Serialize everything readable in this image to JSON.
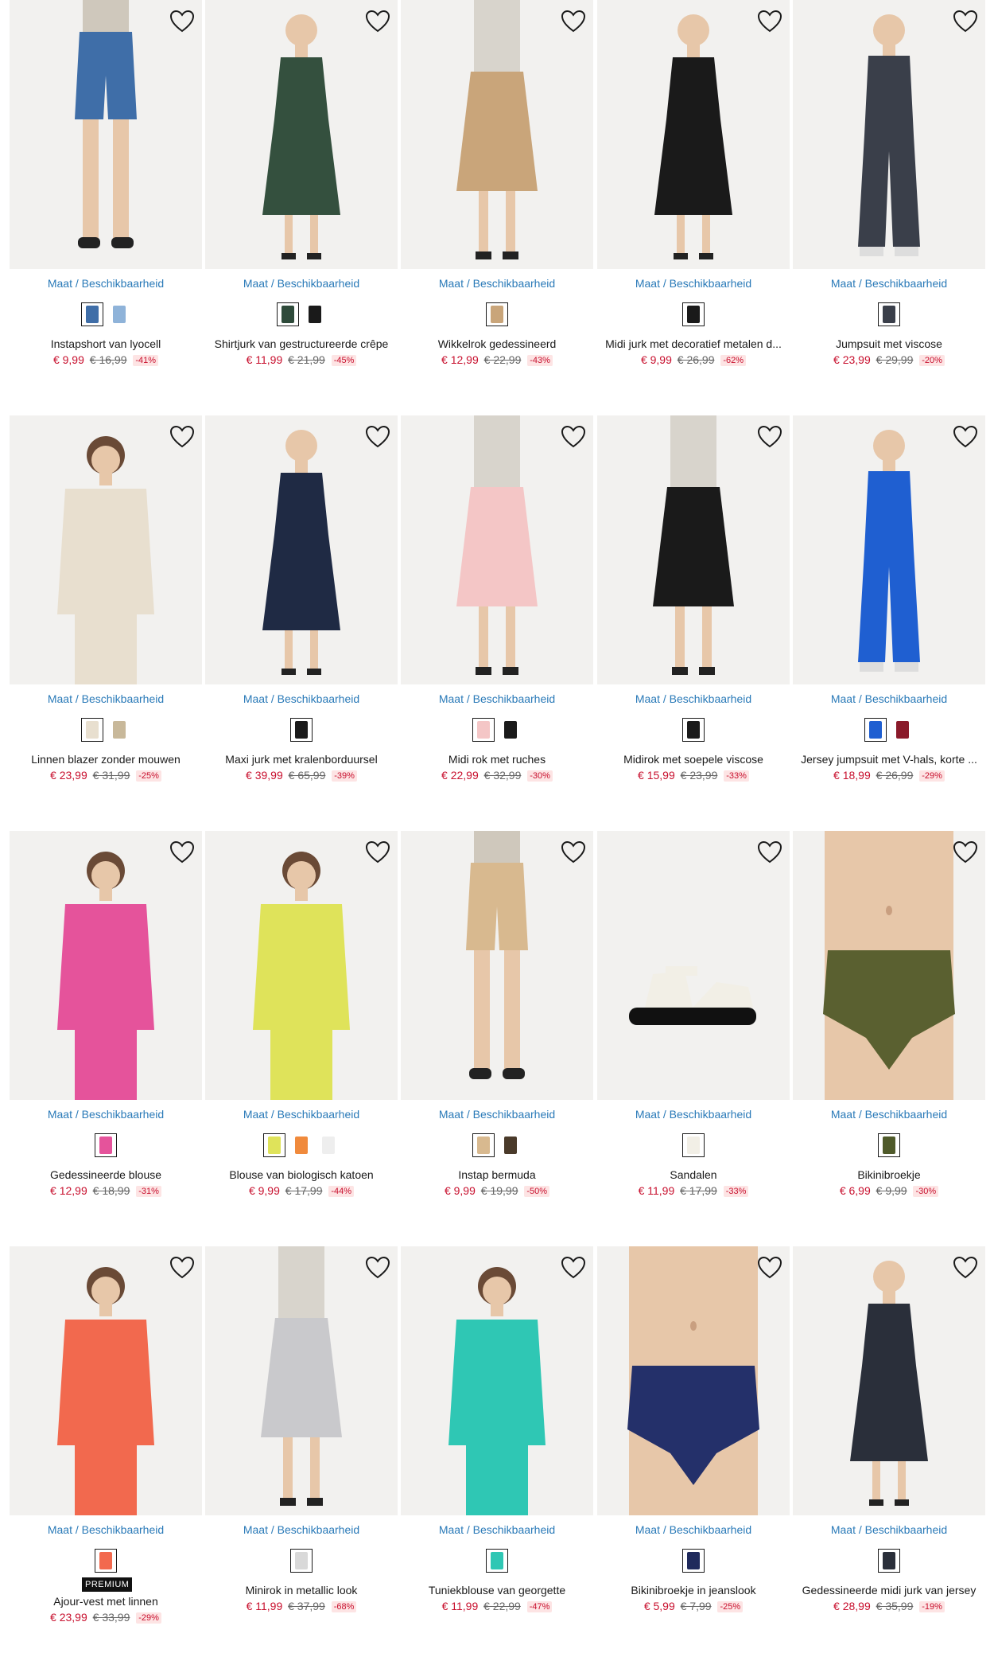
{
  "size_link_label": "Maat / Beschikbaarheid",
  "icons": {
    "wishlist": "heart-outline-icon"
  },
  "colors": {
    "price": "#c8102e",
    "link": "#2a7ab8",
    "discount_bg": "#fde4e4"
  },
  "rows": [
    {
      "products": [
        {
          "name": "Instapshort van lyocell",
          "price": "€ 9,99",
          "old_price": "€ 16,99",
          "discount": "-41%",
          "swatches": [
            "#3f6ea8",
            "#8fb3d9"
          ],
          "garment": "#3f6ea8",
          "type": "shorts"
        },
        {
          "name": "Shirtjurk van gestructureerde crêpe",
          "price": "€ 11,99",
          "old_price": "€ 21,99",
          "discount": "-45%",
          "swatches": [
            "#2e4a3a",
            "#1a1a1a"
          ],
          "garment": "#34503e",
          "type": "dress"
        },
        {
          "name": "Wikkelrok gedessineerd",
          "price": "€ 12,99",
          "old_price": "€ 22,99",
          "discount": "-43%",
          "swatches": [
            "#c9a57a"
          ],
          "garment": "#c9a57a",
          "type": "skirt"
        },
        {
          "name": "Midi jurk met decoratief metalen d...",
          "price": "€ 9,99",
          "old_price": "€ 26,99",
          "discount": "-62%",
          "swatches": [
            "#1a1a1a"
          ],
          "garment": "#1a1a1a",
          "type": "dress"
        },
        {
          "name": "Jumpsuit met viscose",
          "price": "€ 23,99",
          "old_price": "€ 29,99",
          "discount": "-20%",
          "swatches": [
            "#3a3f4a"
          ],
          "garment": "#3a3f4a",
          "type": "jumpsuit"
        }
      ]
    },
    {
      "products": [
        {
          "name": "Linnen blazer zonder mouwen",
          "price": "€ 23,99",
          "old_price": "€ 31,99",
          "discount": "-25%",
          "swatches": [
            "#e8dfcf",
            "#c8b89a"
          ],
          "garment": "#e8dfcf",
          "type": "top"
        },
        {
          "name": "Maxi jurk met kralenborduursel",
          "price": "€ 39,99",
          "old_price": "€ 65,99",
          "discount": "-39%",
          "swatches": [
            "#1a1a1a"
          ],
          "garment": "#1f2a44",
          "type": "dress"
        },
        {
          "name": "Midi rok met ruches",
          "price": "€ 22,99",
          "old_price": "€ 32,99",
          "discount": "-30%",
          "swatches": [
            "#f4c6c6",
            "#1a1a1a"
          ],
          "garment": "#f4c6c6",
          "type": "skirt"
        },
        {
          "name": "Midirok met soepele viscose",
          "price": "€ 15,99",
          "old_price": "€ 23,99",
          "discount": "-33%",
          "swatches": [
            "#1a1a1a"
          ],
          "garment": "#1a1a1a",
          "type": "skirt"
        },
        {
          "name": "Jersey jumpsuit met V-hals, korte ...",
          "price": "€ 18,99",
          "old_price": "€ 26,99",
          "discount": "-29%",
          "swatches": [
            "#1f5fd1",
            "#8a1a2a"
          ],
          "garment": "#1f5fd1",
          "type": "jumpsuit"
        }
      ]
    },
    {
      "products": [
        {
          "name": "Gedessineerde blouse",
          "price": "€ 12,99",
          "old_price": "€ 18,99",
          "discount": "-31%",
          "swatches": [
            "#e5539b"
          ],
          "garment": "#e5539b",
          "type": "top"
        },
        {
          "name": "Blouse van biologisch katoen",
          "price": "€ 9,99",
          "old_price": "€ 17,99",
          "discount": "-44%",
          "swatches": [
            "#dfe35a",
            "#f08a3c",
            "#eeeeee"
          ],
          "garment": "#dfe35a",
          "type": "top"
        },
        {
          "name": "Instap bermuda",
          "price": "€ 9,99",
          "old_price": "€ 19,99",
          "discount": "-50%",
          "swatches": [
            "#d8b98f",
            "#4a3a2a"
          ],
          "garment": "#d8b98f",
          "type": "shorts"
        },
        {
          "name": "Sandalen",
          "price": "€ 11,99",
          "old_price": "€ 17,99",
          "discount": "-33%",
          "swatches": [
            "#f2efe6"
          ],
          "garment": "#f2efe6",
          "type": "shoe"
        },
        {
          "name": "Bikinibroekje",
          "price": "€ 6,99",
          "old_price": "€ 9,99",
          "discount": "-30%",
          "swatches": [
            "#4f5a2a"
          ],
          "garment": "#5a6030",
          "type": "bikini"
        }
      ]
    },
    {
      "products": [
        {
          "name": "Ajour-vest met linnen",
          "price": "€ 23,99",
          "old_price": "€ 33,99",
          "discount": "-29%",
          "swatches": [
            "#f2694e"
          ],
          "garment": "#f2694e",
          "type": "top",
          "badge": "PREMIUM"
        },
        {
          "name": "Minirok in metallic look",
          "price": "€ 11,99",
          "old_price": "€ 37,99",
          "discount": "-68%",
          "swatches": [
            "#d9d9d9"
          ],
          "garment": "#c9c9cc",
          "type": "skirt"
        },
        {
          "name": "Tuniekblouse van georgette",
          "price": "€ 11,99",
          "old_price": "€ 22,99",
          "discount": "-47%",
          "swatches": [
            "#2fc7b4"
          ],
          "garment": "#2fc7b4",
          "type": "top"
        },
        {
          "name": "Bikinibroekje in jeanslook",
          "price": "€ 5,99",
          "old_price": "€ 7,99",
          "discount": "-25%",
          "swatches": [
            "#1f2a5c"
          ],
          "garment": "#24306a",
          "type": "bikini"
        },
        {
          "name": "Gedessineerde midi jurk van jersey",
          "price": "€ 28,99",
          "old_price": "€ 35,99",
          "discount": "-19%",
          "swatches": [
            "#2a2f3a"
          ],
          "garment": "#2a2f3a",
          "type": "dress"
        }
      ]
    }
  ]
}
